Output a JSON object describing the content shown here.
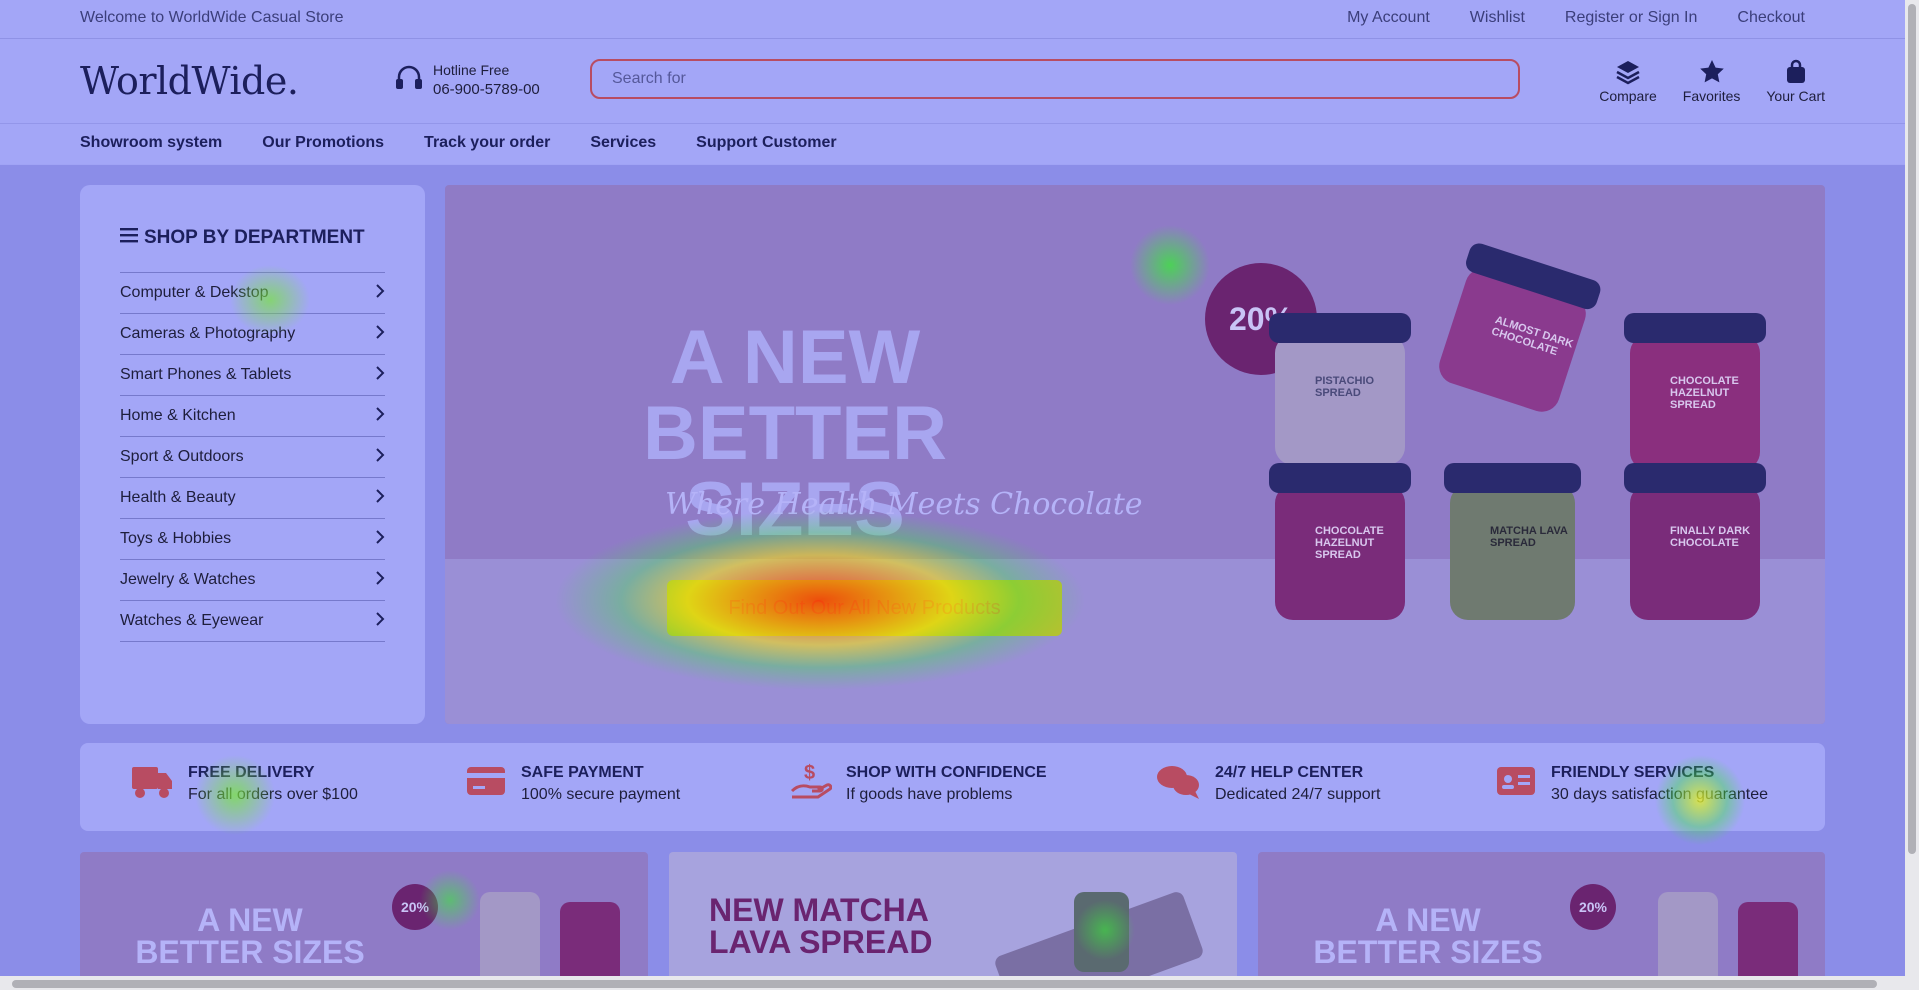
{
  "topbar": {
    "welcome": "Welcome to WorldWide Casual Store",
    "links": [
      "My Account",
      "Wishlist",
      "Register or Sign In",
      "Checkout"
    ]
  },
  "header": {
    "logo": "WorldWide.",
    "hotline_label": "Hotline Free",
    "hotline_number": "06-900-5789-00",
    "search_placeholder": "Search for",
    "icons": [
      {
        "label": "Compare",
        "icon": "layers-icon"
      },
      {
        "label": "Favorites",
        "icon": "star-icon"
      },
      {
        "label": "Your Cart",
        "icon": "bag-icon"
      }
    ]
  },
  "nav": {
    "items": [
      "Showroom system",
      "Our Promotions",
      "Track your order",
      "Services",
      "Support Customer"
    ]
  },
  "department": {
    "title": "SHOP BY DEPARTMENT",
    "items": [
      "Computer & Dekstop",
      "Cameras & Photography",
      "Smart Phones & Tablets",
      "Home & Kitchen",
      "Sport & Outdoors",
      "Health & Beauty",
      "Toys & Hobbies",
      "Jewelry & Watches",
      "Watches & Eyewear"
    ]
  },
  "banner": {
    "headline_1": "A NEW",
    "headline_2": "BETTER SIZES",
    "subtitle": "Where Health Meets Chocolate",
    "cta": "Find Out Our All New Products",
    "badge": "20%",
    "jar_labels": [
      "PISTACHIO SPREAD",
      "ALMOST DARK CHOCOLATE",
      "CHOCOLATE HAZELNUT SPREAD",
      "CHOCOLATE HAZELNUT SPREAD",
      "MATCHA LAVA SPREAD",
      "FINALLY DARK CHOCOLATE"
    ]
  },
  "features": [
    {
      "title": "FREE DELIVERY",
      "subtitle": "For all orders over $100",
      "icon": "truck-icon"
    },
    {
      "title": "SAFE PAYMENT",
      "subtitle": "100% secure payment",
      "icon": "credit-card-icon"
    },
    {
      "title": "SHOP WITH CONFIDENCE",
      "subtitle": "If goods have problems",
      "icon": "hand-money-icon"
    },
    {
      "title": "24/7 HELP CENTER",
      "subtitle": "Dedicated 24/7 support",
      "icon": "chat-icon"
    },
    {
      "title": "FRIENDLY SERVICES",
      "subtitle": "30 days satisfaction guarantee",
      "icon": "id-card-icon"
    }
  ],
  "promos": [
    {
      "line1": "A NEW",
      "line2": "BETTER SIZES",
      "badge": "20%"
    },
    {
      "line1": "NEW MATCHA",
      "line2": "LAVA SPREAD"
    },
    {
      "line1": "A NEW",
      "line2": "BETTER SIZES",
      "badge": "20%"
    }
  ],
  "colors": {
    "overlay": "#a0a3f5",
    "brand": "#1c1f5c",
    "search_border": "#b84c62",
    "cta": "#b8c030"
  }
}
